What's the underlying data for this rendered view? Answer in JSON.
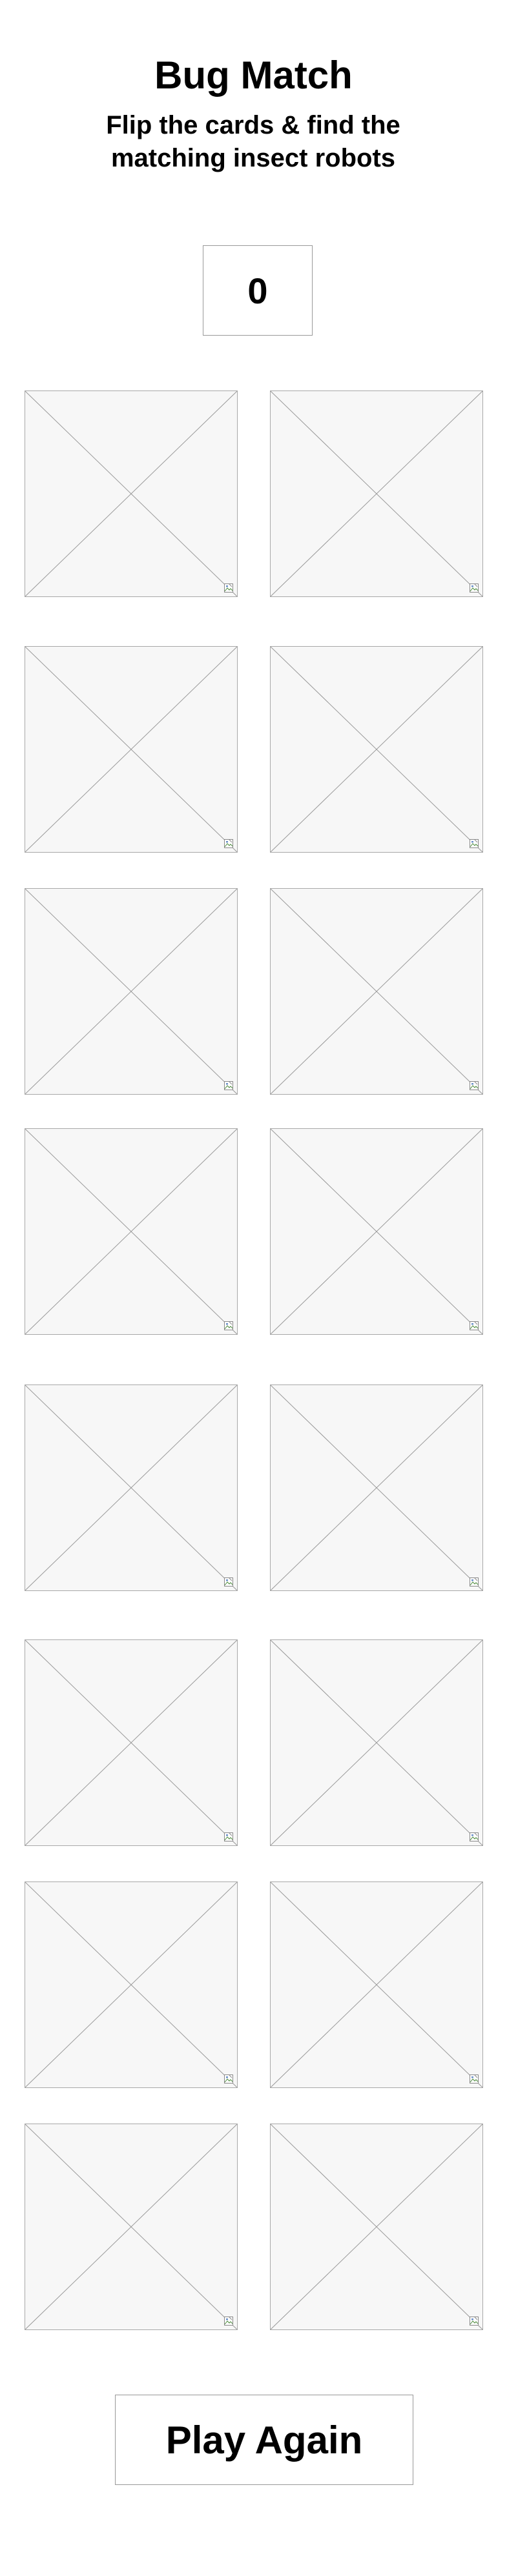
{
  "game": {
    "title": "Bug Match",
    "subtitle": "Flip the cards & find the matching insect robots",
    "score": "0"
  },
  "cards": [
    {
      "state": "face-down",
      "image": "broken-image-icon"
    },
    {
      "state": "face-down",
      "image": "broken-image-icon"
    },
    {
      "state": "face-down",
      "image": "broken-image-icon"
    },
    {
      "state": "face-down",
      "image": "broken-image-icon"
    },
    {
      "state": "face-down",
      "image": "broken-image-icon"
    },
    {
      "state": "face-down",
      "image": "broken-image-icon"
    },
    {
      "state": "face-down",
      "image": "broken-image-icon"
    },
    {
      "state": "face-down",
      "image": "broken-image-icon"
    },
    {
      "state": "face-down",
      "image": "broken-image-icon"
    },
    {
      "state": "face-down",
      "image": "broken-image-icon"
    },
    {
      "state": "face-down",
      "image": "broken-image-icon"
    },
    {
      "state": "face-down",
      "image": "broken-image-icon"
    },
    {
      "state": "face-down",
      "image": "broken-image-icon"
    },
    {
      "state": "face-down",
      "image": "broken-image-icon"
    },
    {
      "state": "face-down",
      "image": "broken-image-icon"
    },
    {
      "state": "face-down",
      "image": "broken-image-icon"
    }
  ],
  "controls": {
    "play_again_label": "Play Again"
  }
}
